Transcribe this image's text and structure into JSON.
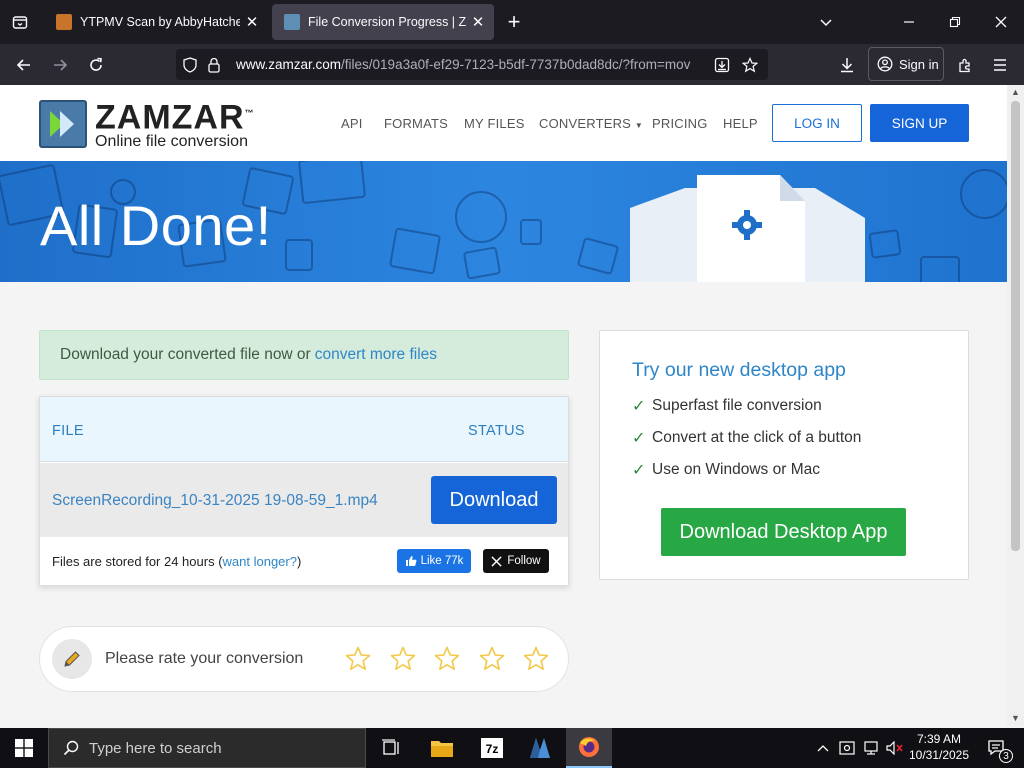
{
  "browser": {
    "tabs": [
      {
        "title": "YTPMV Scan by AbbyHatcheran",
        "active": false
      },
      {
        "title": "File Conversion Progress | Zamzar",
        "active": true
      }
    ],
    "url_prefix": "www.zamzar.com",
    "url_rest": "/files/019a3a0f-ef29-7123-b5df-7737b0dad8dc/?from=mov",
    "sign_in_label": "Sign in"
  },
  "site": {
    "logo_name": "ZAMZAR",
    "logo_tm": "™",
    "logo_tagline": "Online file conversion",
    "menu": [
      "API",
      "FORMATS",
      "MY FILES",
      "CONVERTERS",
      "PRICING",
      "HELP"
    ],
    "login_label": "LOG IN",
    "signup_label": "SIGN UP"
  },
  "hero": {
    "title": "All Done!"
  },
  "notice": {
    "text": "Download your converted file now or",
    "link": "convert more files"
  },
  "files": {
    "col_file": "FILE",
    "col_status": "STATUS",
    "rows": [
      {
        "name": "ScreenRecording_10-31-2025 19-08-59_1.mp4",
        "action": "Download"
      }
    ],
    "stored_text": "Files are stored for 24 hours (",
    "stored_link": "want longer?",
    "stored_close": ")",
    "like_label": "Like 77k",
    "follow_label": "Follow"
  },
  "rating": {
    "prompt": "Please rate your conversion",
    "stars": 5,
    "rating": 0,
    "star_color": "#f2c94c"
  },
  "desktop_app": {
    "heading": "Try our new desktop app",
    "features": [
      "Superfast file conversion",
      "Convert at the click of a button",
      "Use on Windows or Mac"
    ],
    "button_label": "Download Desktop App"
  },
  "taskbar": {
    "search_placeholder": "Type here to search",
    "time": "7:39 AM",
    "date": "10/31/2025",
    "notification_count": "3"
  },
  "colors": {
    "primary_blue": "#1565d8",
    "link_blue": "#2e86c8",
    "green": "#28a745",
    "notice_bg": "#d5ecdc"
  }
}
